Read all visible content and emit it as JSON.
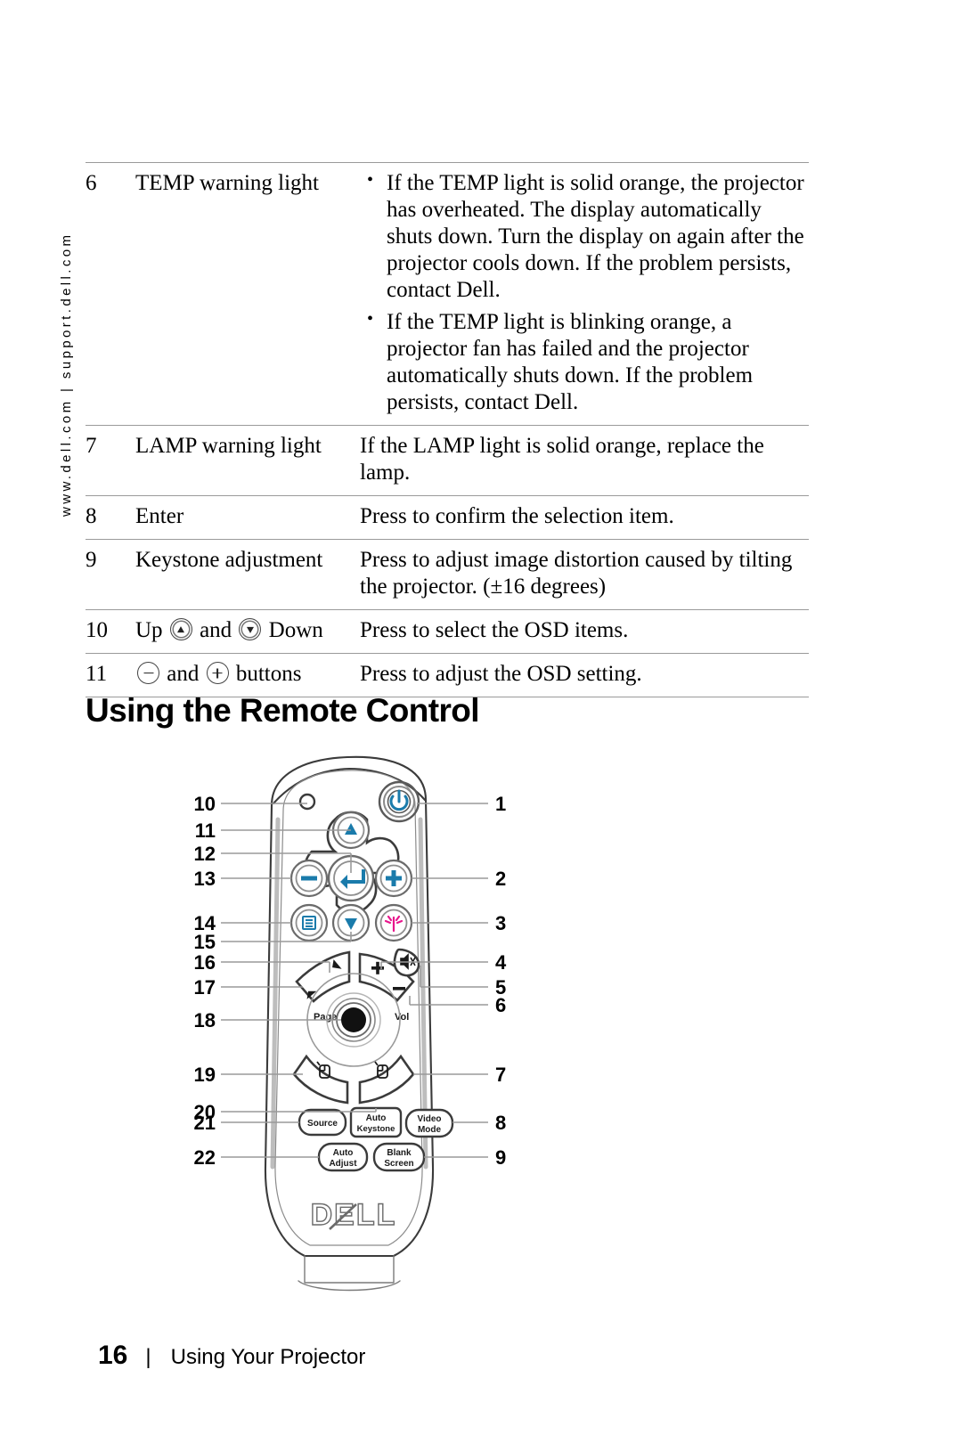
{
  "sidebar": {
    "vertical_text": "www.dell.com | support.dell.com"
  },
  "table": {
    "rows": [
      {
        "num": "6",
        "name": "TEMP warning light",
        "bullets": [
          "If the TEMP light is solid orange, the projector has overheated. The display automatically shuts down. Turn the display on again after the projector cools down. If the problem persists, contact Dell.",
          "If the TEMP light is blinking orange, a projector fan has failed and the projector automatically shuts down. If the problem persists, contact Dell."
        ]
      },
      {
        "num": "7",
        "name": "LAMP warning light",
        "desc": "If the LAMP light is solid orange, replace the lamp."
      },
      {
        "num": "8",
        "name": "Enter",
        "desc": "Press to confirm the selection item."
      },
      {
        "num": "9",
        "name": "Keystone adjustment",
        "desc": "Press to adjust image distortion caused by tilting the projector. (±16 degrees)"
      },
      {
        "num": "10",
        "name_parts": {
          "pre": "Up ",
          "mid": " and ",
          "post": " Down"
        },
        "desc": "Press to select the OSD items."
      },
      {
        "num": "11",
        "name_parts": {
          "pre": "",
          "mid": " and ",
          "post": " buttons"
        },
        "desc": "Press to adjust the OSD setting."
      }
    ]
  },
  "heading": "Using the Remote Control",
  "figure": {
    "callouts_left": [
      "10",
      "11",
      "12",
      "13",
      "14",
      "15",
      "16",
      "17",
      "18",
      "19",
      "20",
      "21",
      "22"
    ],
    "callouts_right": [
      "1",
      "2",
      "3",
      "4",
      "5",
      "6",
      "7",
      "8",
      "9"
    ],
    "labels": {
      "page": "Page",
      "vol": "Vol"
    },
    "buttons": [
      {
        "line1": "Source",
        "line2": ""
      },
      {
        "line1": "Auto",
        "line2": "Keystone"
      },
      {
        "line1": "Video",
        "line2": "Mode"
      },
      {
        "line1": "Auto",
        "line2": "Adjust"
      },
      {
        "line1": "Blank",
        "line2": "Screen"
      }
    ],
    "brand": "DELL",
    "colors": {
      "power_blue": "#1a7bab",
      "keystone_magenta": "#e8158c",
      "outline": "#3b3b3b"
    }
  },
  "footer": {
    "page_number": "16",
    "separator": "|",
    "title": "Using Your Projector"
  }
}
